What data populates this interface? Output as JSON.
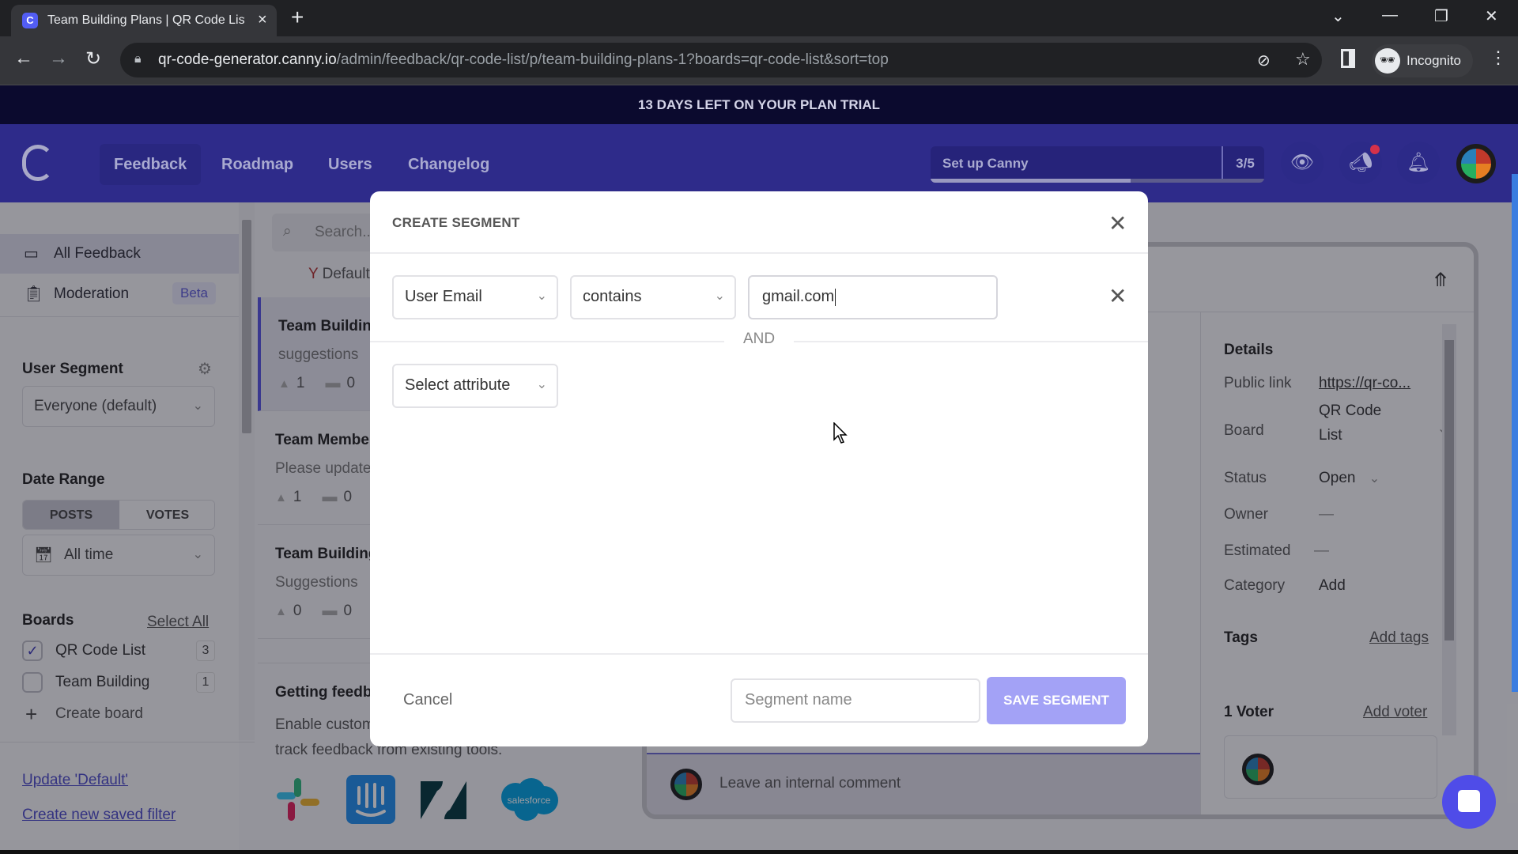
{
  "browser": {
    "tab_title": "Team Building Plans | QR Code List",
    "tab_favicon": "canny-logo-icon",
    "new_tab": "+",
    "url_host": "qr-code-generator.canny.io",
    "url_path": "/admin/feedback/qr-code-list/p/team-building-plans-1?boards=qr-code-list&sort=top",
    "profile_label": "Incognito"
  },
  "trial_banner": "13 DAYS LEFT ON YOUR PLAN TRIAL",
  "nav": {
    "items": [
      {
        "label": "Feedback",
        "active": true
      },
      {
        "label": "Roadmap",
        "active": false
      },
      {
        "label": "Users",
        "active": false
      },
      {
        "label": "Changelog",
        "active": false
      }
    ],
    "setup_label": "Set up Canny",
    "setup_count": "3/5",
    "setup_progress": 0.6
  },
  "sidebar": {
    "all_feedback": "All Feedback",
    "moderation": "Moderation",
    "beta_badge": "Beta",
    "user_segment_heading": "User Segment",
    "user_segment_value": "Everyone (default)",
    "date_range_heading": "Date Range",
    "toggle_posts": "POSTS",
    "toggle_votes": "VOTES",
    "date_value": "All time",
    "boards_heading": "Boards",
    "select_all": "Select All",
    "boards": [
      {
        "name": "QR Code List",
        "count": "3",
        "checked": true
      },
      {
        "name": "Team Building",
        "count": "1",
        "checked": false
      }
    ],
    "create_board": "Create board",
    "update_default": "Update 'Default'",
    "create_saved_filter": "Create new saved filter"
  },
  "post_list": {
    "search_placeholder": "Search...",
    "filter_label": "Default",
    "posts": [
      {
        "title": "Team Building Plans",
        "desc": "suggestions",
        "votes": "1",
        "comments": "0"
      },
      {
        "title": "Team Members",
        "desc": "Please update",
        "votes": "1",
        "comments": "0"
      },
      {
        "title": "Team Building",
        "desc": "Suggestions",
        "votes": "0",
        "comments": "0"
      }
    ],
    "getting_heading": "Getting feedback",
    "getting_desc_1": "Enable customers to",
    "getting_desc_2": "track feedback from existing tools.",
    "integrations": [
      "Slack",
      "Intercom",
      "Zendesk",
      "salesforce"
    ]
  },
  "detail": {
    "details_heading": "Details",
    "rows": [
      {
        "label": "Public link",
        "value": "https://qr-co..."
      },
      {
        "label": "Board",
        "value": "QR Code List"
      },
      {
        "label": "Status",
        "value": "Open"
      },
      {
        "label": "Owner",
        "value": "—"
      },
      {
        "label": "Estimated",
        "value": "—"
      },
      {
        "label": "Category",
        "value": "Add"
      }
    ],
    "tags_heading": "Tags",
    "add_tags": "Add tags",
    "voters_heading": "1 Voter",
    "add_voter": "Add voter",
    "comment_placeholder": "Leave an internal comment"
  },
  "modal": {
    "title": "CREATE SEGMENT",
    "attribute": "User Email",
    "operator": "contains",
    "value": "gmail.com",
    "and_label": "AND",
    "next_attribute_placeholder": "Select attribute",
    "cancel": "Cancel",
    "segment_name_placeholder": "Segment name",
    "save": "SAVE SEGMENT"
  },
  "colors": {
    "nav_bg": "#2e2b8a",
    "trial_bg": "#0b0a2e",
    "accent": "#5653e0",
    "save_disabled": "#a3a2f6"
  }
}
